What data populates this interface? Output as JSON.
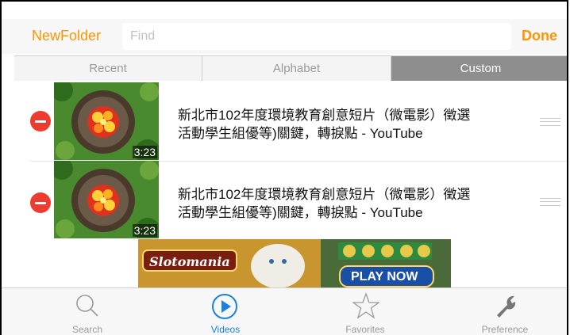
{
  "header": {
    "new_folder_label": "NewFolder",
    "search_placeholder": "Find",
    "done_label": "Done"
  },
  "segments": [
    {
      "label": "Recent",
      "selected": false
    },
    {
      "label": "Alphabet",
      "selected": false
    },
    {
      "label": "Custom",
      "selected": true
    }
  ],
  "videos": [
    {
      "title_line1": "新北市102年度環境教育創意短片（微電影）徵選",
      "title_line2": "活動學生組優等)關鍵，轉捩點 - YouTube",
      "duration": "3:23",
      "thumbnail_icon": "video-thumbnail"
    },
    {
      "title_line1": "新北市102年度環境教育創意短片（微電影）徵選",
      "title_line2": "活動學生組優等)關鍵，轉捩點 - YouTube",
      "duration": "3:23",
      "thumbnail_icon": "video-thumbnail"
    }
  ],
  "ad": {
    "brand": "Slotomania",
    "cta": "PLAY NOW"
  },
  "tabbar": [
    {
      "label": "Search",
      "icon": "search-icon",
      "active": false
    },
    {
      "label": "Videos",
      "icon": "play-circle-icon",
      "active": true
    },
    {
      "label": "Favorites",
      "icon": "star-icon",
      "active": false
    },
    {
      "label": "Preference",
      "icon": "wrench-icon",
      "active": false
    }
  ],
  "colors": {
    "accent": "#ff9500",
    "active_tab": "#1a80e6",
    "delete": "#ee3b2f",
    "segment_selected": "#8e8e8e"
  }
}
